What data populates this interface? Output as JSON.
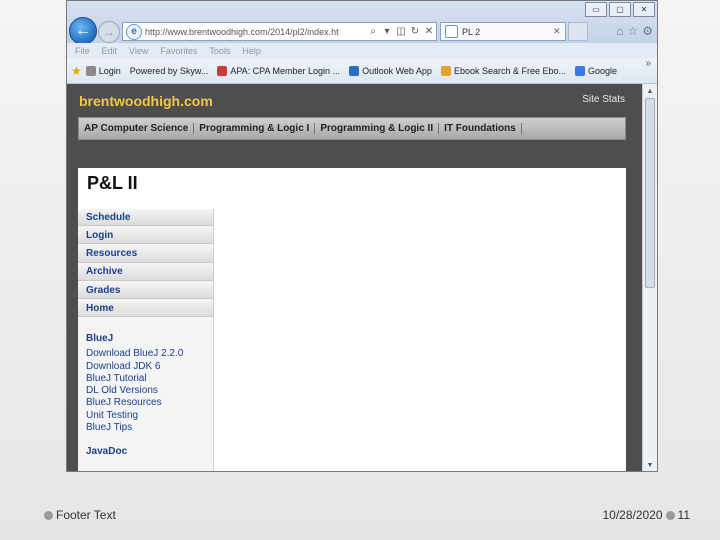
{
  "browser": {
    "url": "http://www.brentwoodhigh.com/2014/pl2/index.ht",
    "tab_title": "PL 2",
    "menu": [
      "File",
      "Edit",
      "View",
      "Favorites",
      "Tools",
      "Help"
    ],
    "window_buttons": [
      "▭",
      "▢",
      "✕"
    ],
    "favorites": [
      {
        "label": "Login",
        "icon": "signal-icon",
        "color": "#8a8a8a"
      },
      {
        "label": "Powered by Skyw...",
        "icon": "page-icon",
        "color": "#9a9a9a"
      },
      {
        "label": "APA: CPA Member Login ...",
        "icon": "apa-icon",
        "color": "#c43c3c"
      },
      {
        "label": "Outlook Web App",
        "icon": "outlook-icon",
        "color": "#2a6fc4"
      },
      {
        "label": "Ebook Search & Free Ebo...",
        "icon": "book-icon",
        "color": "#e6a32a"
      },
      {
        "label": "Google",
        "icon": "google-icon",
        "color": "#3b78e7"
      }
    ]
  },
  "site": {
    "logo": "brentwoodhigh.com",
    "stats": "Site Stats",
    "nav": [
      "AP Computer Science",
      "Programming & Logic I",
      "Programming & Logic II",
      "IT Foundations"
    ],
    "page_title": "P&L II",
    "sidebar": {
      "links": [
        "Schedule",
        "Login",
        "Resources",
        "Archive",
        "Grades",
        "Home"
      ],
      "bluej_heading": "BlueJ",
      "bluej_links": [
        "Download BlueJ 2.2.0",
        "Download JDK 6",
        "BlueJ Tutorial",
        "DL Old Versions",
        "BlueJ Resources",
        "Unit Testing",
        "BlueJ Tips"
      ],
      "next_heading": "JavaDoc"
    }
  },
  "footer": {
    "left": "Footer Text",
    "date": "10/28/2020",
    "page": "11"
  }
}
